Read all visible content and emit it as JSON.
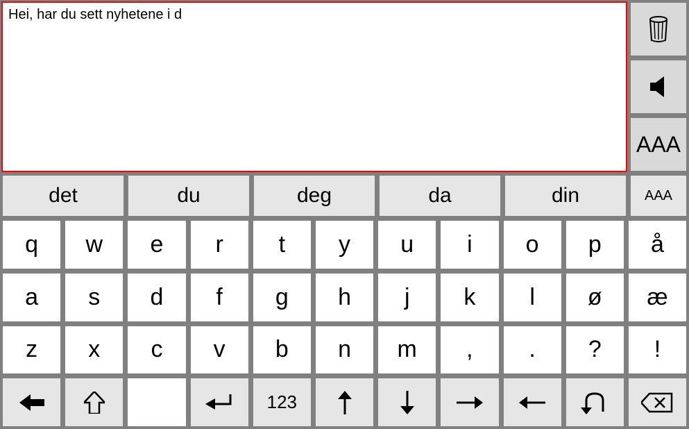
{
  "text_input": "Hei,  har du sett nyhetene i d",
  "side": {
    "trash_label": "AAA",
    "aaa_large": "AAA"
  },
  "suggestions": [
    "det",
    "du",
    "deg",
    "da",
    "din"
  ],
  "suggestion_small": "AAA",
  "rows": [
    [
      "q",
      "w",
      "e",
      "r",
      "t",
      "y",
      "u",
      "i",
      "o",
      "p",
      "å"
    ],
    [
      "a",
      "s",
      "d",
      "f",
      "g",
      "h",
      "j",
      "k",
      "l",
      "ø",
      "æ"
    ],
    [
      "z",
      "x",
      "c",
      "v",
      "b",
      "n",
      "m",
      ",",
      ".",
      "?",
      "!"
    ]
  ],
  "func_row": {
    "numeric": "123"
  }
}
